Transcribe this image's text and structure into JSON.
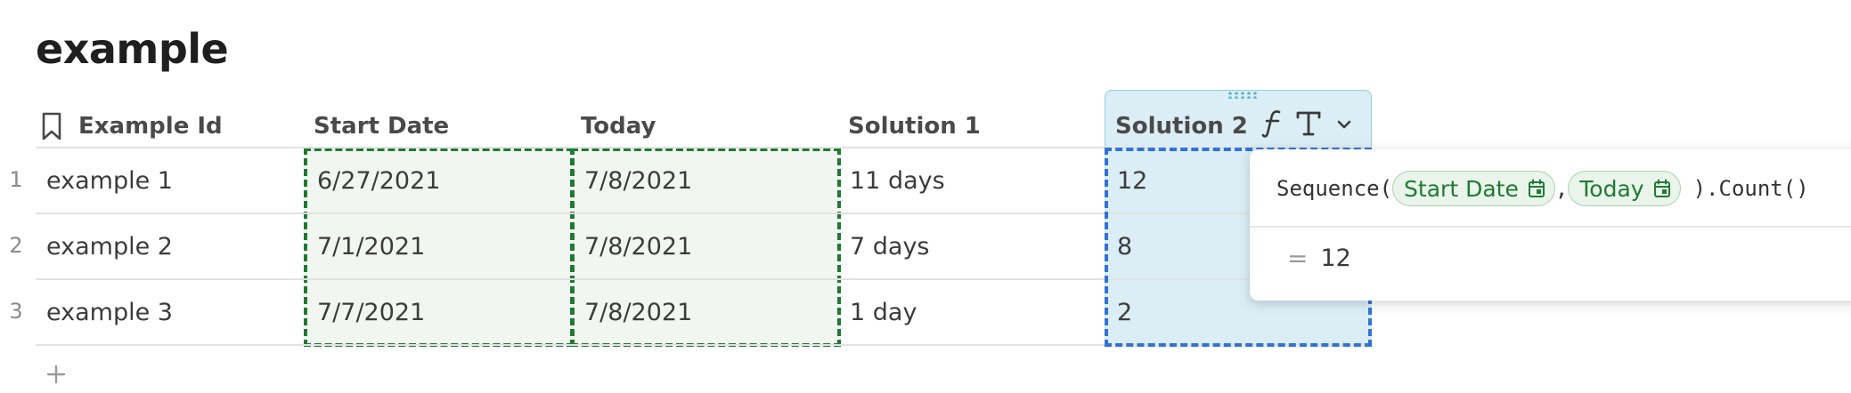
{
  "page": {
    "title": "example"
  },
  "table": {
    "columns": [
      {
        "key": "example_id",
        "label": "Example Id"
      },
      {
        "key": "start_date",
        "label": "Start Date"
      },
      {
        "key": "today",
        "label": "Today"
      },
      {
        "key": "solution1",
        "label": "Solution 1"
      },
      {
        "key": "solution2",
        "label": "Solution 2"
      }
    ],
    "rows": [
      {
        "num": "1",
        "example_id": "example 1",
        "start_date": "6/27/2021",
        "today": "7/8/2021",
        "solution1": "11 days",
        "solution2": "12"
      },
      {
        "num": "2",
        "example_id": "example 2",
        "start_date": "7/1/2021",
        "today": "7/8/2021",
        "solution1": "7 days",
        "solution2": "8"
      },
      {
        "num": "3",
        "example_id": "example 3",
        "start_date": "7/7/2021",
        "today": "7/8/2021",
        "solution1": "1 day",
        "solution2": "2"
      }
    ],
    "add_row_icon": "plus-icon",
    "key_column_icon": "bookmark-icon"
  },
  "column_header_controls": {
    "solution2": [
      "formula-icon",
      "text-type-icon",
      "chevron-down-icon",
      "drag-handle-icon"
    ]
  },
  "formula_popup": {
    "fn_open": "Sequence(",
    "arg1": "Start Date",
    "comma": ",",
    "arg2": "Today",
    "fn_close": ").Count()",
    "equals": "=",
    "result": "12",
    "chip_icon": "calendar-icon"
  },
  "colors": {
    "selection_green": "#1f7a33",
    "selection_blue": "#2f73d8",
    "selected_column_bg": "#dbedf5",
    "chip_bg": "#e9f4ea",
    "chip_text": "#217a34"
  }
}
